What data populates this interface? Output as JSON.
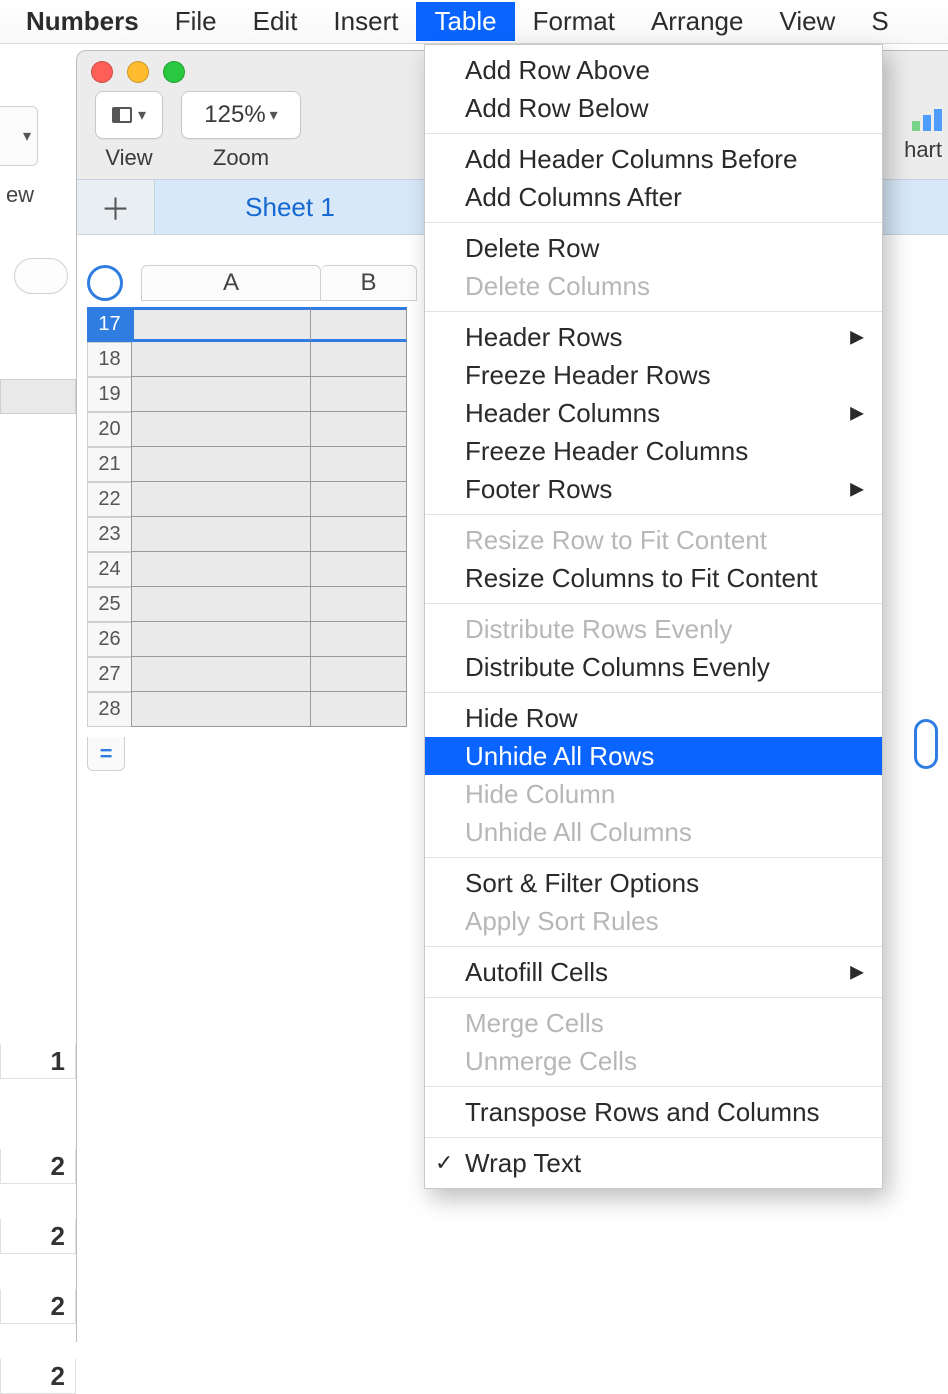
{
  "menubar": {
    "app": "Numbers",
    "items": [
      "File",
      "Edit",
      "Insert",
      "Table",
      "Format",
      "Arrange",
      "View",
      "S"
    ],
    "active_index": 3
  },
  "bg_window": {
    "tab_suffix": "ew",
    "visible_row_labels": [
      "1",
      "2",
      "2",
      "2",
      "2"
    ]
  },
  "fg_window": {
    "toolbar": {
      "view_label": "View",
      "zoom_value": "125%",
      "zoom_label": "Zoom"
    },
    "chart_label": "hart",
    "sheet_tab": "Sheet 1",
    "columns": [
      "A",
      "B"
    ],
    "selected_row": 17,
    "rows": [
      17,
      18,
      19,
      20,
      21,
      22,
      23,
      24,
      25,
      26,
      27,
      28
    ]
  },
  "dropdown": {
    "groups": [
      [
        {
          "label": "Add Row Above",
          "enabled": true
        },
        {
          "label": "Add Row Below",
          "enabled": true
        }
      ],
      [
        {
          "label": "Add Header Columns Before",
          "enabled": true
        },
        {
          "label": "Add Columns After",
          "enabled": true
        }
      ],
      [
        {
          "label": "Delete Row",
          "enabled": true
        },
        {
          "label": "Delete Columns",
          "enabled": false
        }
      ],
      [
        {
          "label": "Header Rows",
          "enabled": true,
          "submenu": true
        },
        {
          "label": "Freeze Header Rows",
          "enabled": true
        },
        {
          "label": "Header Columns",
          "enabled": true,
          "submenu": true
        },
        {
          "label": "Freeze Header Columns",
          "enabled": true
        },
        {
          "label": "Footer Rows",
          "enabled": true,
          "submenu": true
        }
      ],
      [
        {
          "label": "Resize Row to Fit Content",
          "enabled": false
        },
        {
          "label": "Resize Columns to Fit Content",
          "enabled": true
        }
      ],
      [
        {
          "label": "Distribute Rows Evenly",
          "enabled": false
        },
        {
          "label": "Distribute Columns Evenly",
          "enabled": true
        }
      ],
      [
        {
          "label": "Hide Row",
          "enabled": true
        },
        {
          "label": "Unhide All Rows",
          "enabled": true,
          "highlight": true
        },
        {
          "label": "Hide Column",
          "enabled": false
        },
        {
          "label": "Unhide All Columns",
          "enabled": false
        }
      ],
      [
        {
          "label": "Sort & Filter Options",
          "enabled": true
        },
        {
          "label": "Apply Sort Rules",
          "enabled": false
        }
      ],
      [
        {
          "label": "Autofill Cells",
          "enabled": true,
          "submenu": true
        }
      ],
      [
        {
          "label": "Merge Cells",
          "enabled": false
        },
        {
          "label": "Unmerge Cells",
          "enabled": false
        }
      ],
      [
        {
          "label": "Transpose Rows and Columns",
          "enabled": true
        }
      ],
      [
        {
          "label": "Wrap Text",
          "enabled": true,
          "checked": true
        }
      ]
    ]
  }
}
